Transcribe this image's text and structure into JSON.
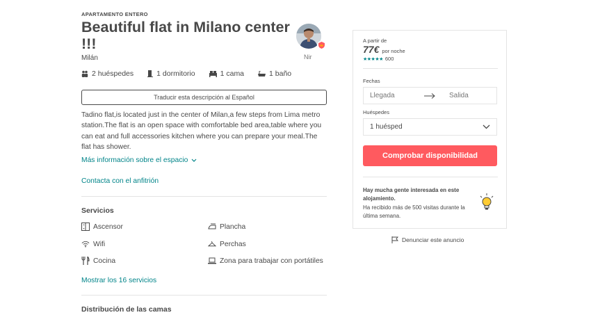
{
  "listing": {
    "type_label": "APARTAMENTO ENTERO",
    "title": "Beautiful flat in Milano center !!!",
    "city": "Milán",
    "host_name": "Nir",
    "facts": {
      "guests": "2 huéspedes",
      "bedrooms": "1 dormitorio",
      "beds": "1 cama",
      "baths": "1 baño"
    },
    "translate_label": "Traducir esta descripción al Español",
    "description": "Tadino flat,is located just in the center of Milan,a few steps from Lima metro station.The flat is an open space with comfortable bed area,table where you can eat and full accessories kitchen where you can prepare your meal.The flat has shower.",
    "more_info": "Más información sobre el espacio",
    "contact_host": "Contacta con el anfitrión"
  },
  "amenities": {
    "title": "Servicios",
    "items": [
      {
        "label": "Ascensor",
        "icon": "elevator-icon"
      },
      {
        "label": "Plancha",
        "icon": "iron-icon"
      },
      {
        "label": "Wifi",
        "icon": "wifi-icon"
      },
      {
        "label": "Perchas",
        "icon": "hanger-icon"
      },
      {
        "label": "Cocina",
        "icon": "kitchen-icon"
      },
      {
        "label": "Zona para trabajar con portátiles",
        "icon": "laptop-icon"
      }
    ],
    "show_all": "Mostrar los 16 servicios"
  },
  "beds_section": {
    "title": "Distribución de las camas"
  },
  "booking": {
    "from_label": "A partir de",
    "price": "77€",
    "per_night": "por noche",
    "stars": "★★★★★",
    "rating": 5,
    "review_count": "600",
    "dates_label": "Fechas",
    "checkin_placeholder": "Llegada",
    "checkout_placeholder": "Salida",
    "guests_label": "Huéspedes",
    "guests_value": "1 huésped",
    "check_button": "Comprobar disponibilidad",
    "notice_title": "Hay mucha gente interesada en este alojamiento.",
    "notice_text": "Ha recibido más de 500 visitas durante la última semana."
  },
  "report_link": "Denunciar este anuncio",
  "colors": {
    "text": "#484848",
    "accent_teal": "#008489",
    "brand_red": "#ff5a5f",
    "border": "#e4e4e4"
  }
}
